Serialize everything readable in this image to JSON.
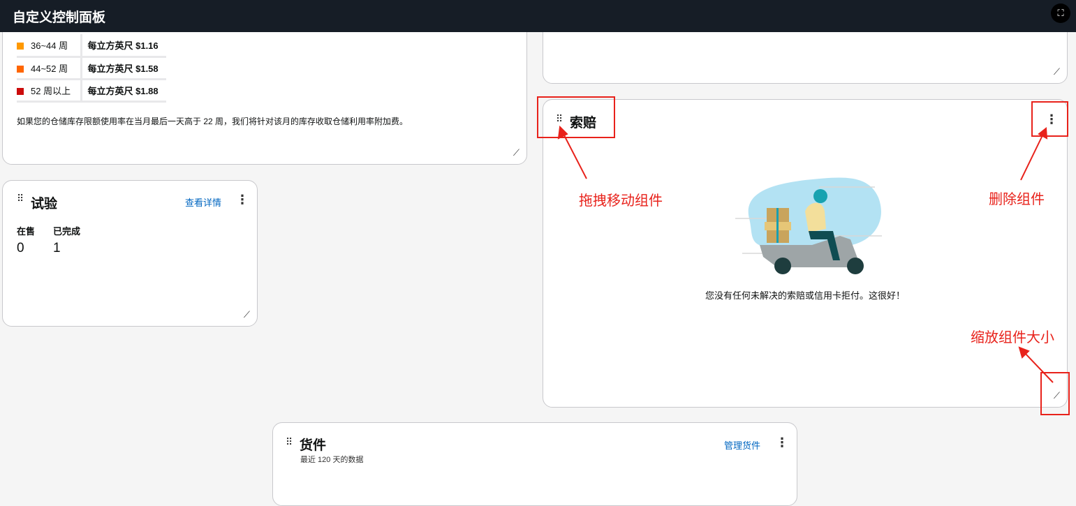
{
  "header": {
    "title": "自定义控制面板",
    "fullscreen_icon": "fullscreen-icon"
  },
  "storage_card": {
    "rows": [
      {
        "label": "36~44 周",
        "value": "每立方英尺 $1.16",
        "color": "#ff9900"
      },
      {
        "label": "44~52 周",
        "value": "每立方英尺 $1.58",
        "color": "#ff6600"
      },
      {
        "label": "52 周以上",
        "value": "每立方英尺 $1.88",
        "color": "#cc0c0c"
      }
    ],
    "note": "如果您的仓储库存限额使用率在当月最后一天高于 22 周，我们将针对该月的库存收取仓储利用率附加费。"
  },
  "trial_card": {
    "title": "试验",
    "link": "查看详情",
    "col1_label": "在售",
    "col1_value": "0",
    "col2_label": "已完成",
    "col2_value": "1"
  },
  "claims_card": {
    "title": "索赔",
    "message": "您没有任何未解决的索赔或信用卡拒付。这很好！"
  },
  "shipments_card": {
    "title": "货件",
    "subtitle": "最近 120 天的数据",
    "link": "管理货件"
  },
  "annotations": {
    "drag": "拖拽移动组件",
    "delete": "删除组件",
    "resize": "缩放组件大小"
  }
}
